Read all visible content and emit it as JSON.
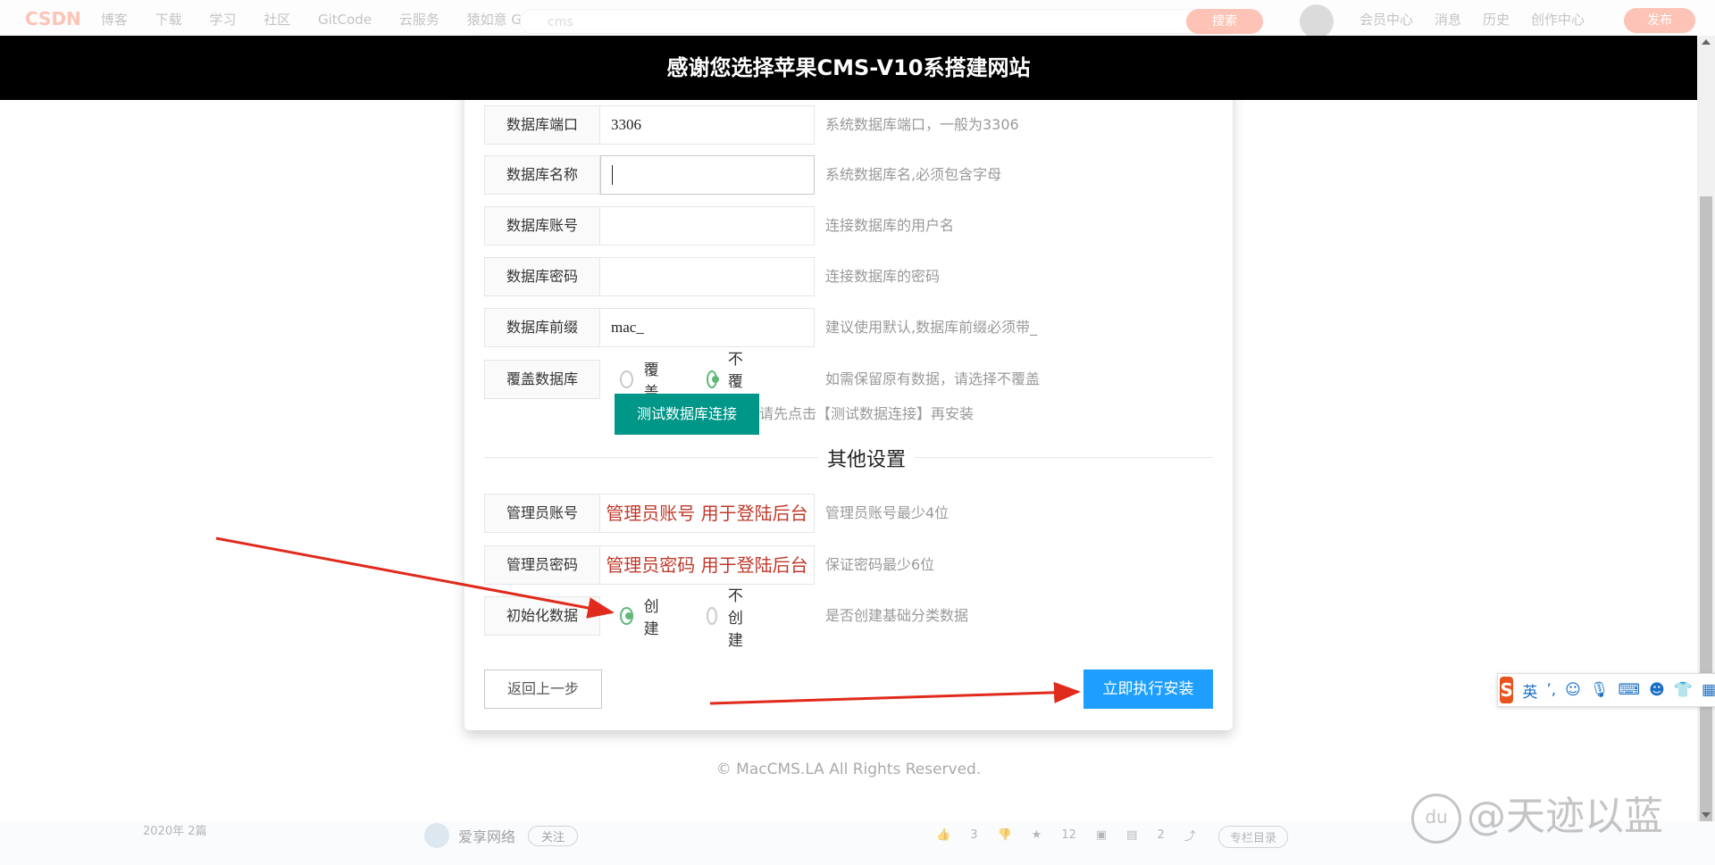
{
  "csdn": {
    "logo": "CSDN",
    "nav": [
      "博客",
      "下载",
      "学习",
      "社区",
      "GitCode",
      "云服务",
      "猿如意 GPT"
    ],
    "search_placeholder": "cms",
    "search_button": "搜索",
    "right": [
      "会员中心",
      "消息",
      "历史",
      "创作中心"
    ],
    "publish": "发布"
  },
  "banner": {
    "title": "感谢您选择苹果CMS-V10系搭建网站"
  },
  "form": {
    "rows": [
      {
        "label": "数据库端口",
        "value": "3306",
        "hint": "系统数据库端口，一般为3306"
      },
      {
        "label": "数据库名称",
        "value": "",
        "hint": "系统数据库名,必须包含字母"
      },
      {
        "label": "数据库账号",
        "value": "",
        "hint": "连接数据库的用户名"
      },
      {
        "label": "数据库密码",
        "value": "",
        "hint": "连接数据库的密码"
      },
      {
        "label": "数据库前缀",
        "value": "mac_",
        "hint": "建议使用默认,数据库前缀必须带_"
      }
    ],
    "cover": {
      "label": "覆盖数据库",
      "options": [
        "覆盖",
        "不覆盖"
      ],
      "selected": "不覆盖",
      "hint": "如需保留原有数据，请选择不覆盖"
    },
    "test_button": "测试数据库连接",
    "test_hint": "请先点击【测试数据连接】再安装",
    "section_title": "其他设置",
    "admin_account": {
      "label": "管理员账号",
      "value": "管理员账号 用于登陆后台",
      "hint": "管理员账号最少4位"
    },
    "admin_password": {
      "label": "管理员密码",
      "value": "管理员密码 用于登陆后台",
      "hint": "保证密码最少6位"
    },
    "init_data": {
      "label": "初始化数据",
      "options": [
        "创建",
        "不创建"
      ],
      "selected": "创建",
      "hint": "是否创建基础分类数据"
    },
    "back_button": "返回上一步",
    "install_button": "立即执行安装"
  },
  "footer": {
    "copyright": "© MacCMS.LA All Rights Reserved."
  },
  "bottom_bar": {
    "year": "2020年 2篇",
    "author": "爱享网络",
    "follow": "关注",
    "likes": "3",
    "stars": "12",
    "comments": "2",
    "catalog": "专栏目录"
  },
  "ime": {
    "logo": "S",
    "mode": "英"
  },
  "watermark": {
    "badge": "du",
    "text": "@天迹以蓝"
  },
  "colors": {
    "test_button": "#009688",
    "install_button": "#1e9fff",
    "radio_checked": "#5fb878",
    "annotation": "#c0392b",
    "arrow": "#e02a1c"
  }
}
